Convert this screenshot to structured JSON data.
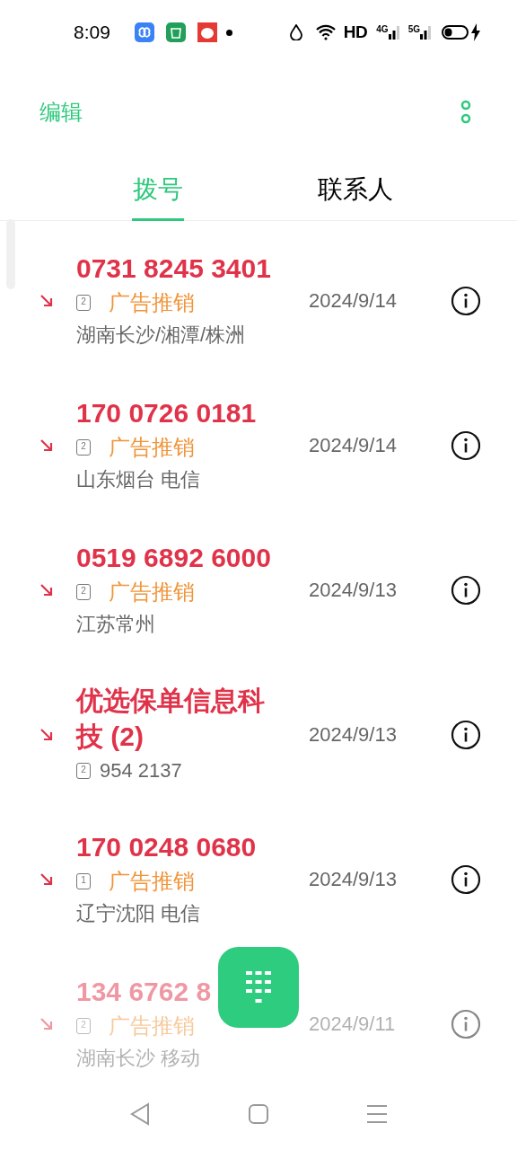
{
  "status_bar": {
    "time": "8:09",
    "hd": "HD",
    "networks": [
      "4G",
      "5G"
    ]
  },
  "header": {
    "edit": "编辑"
  },
  "tabs": [
    {
      "label": "拨号",
      "selected": true
    },
    {
      "label": "联系人",
      "selected": false
    }
  ],
  "calls": [
    {
      "name": "0731 8245 3401",
      "sim": "2",
      "tag": "广告推销",
      "location": "湖南长沙/湘潭/株洲",
      "date": "2024/9/14",
      "faded": false
    },
    {
      "name": "170 0726 0181",
      "sim": "2",
      "tag": "广告推销",
      "location": "山东烟台 电信",
      "date": "2024/9/14",
      "faded": false
    },
    {
      "name": "0519 6892 6000",
      "sim": "2",
      "tag": "广告推销",
      "location": "江苏常州",
      "date": "2024/9/13",
      "faded": false
    },
    {
      "name": "优选保单信息科技 (2)",
      "sim": "2",
      "number": "954 2137",
      "date": "2024/9/13",
      "faded": false
    },
    {
      "name": "170 0248 0680",
      "sim": "1",
      "tag": "广告推销",
      "location": "辽宁沈阳 电信",
      "date": "2024/9/13",
      "faded": false
    },
    {
      "name": "134 6762 8",
      "sim": "2",
      "tag": "广告推销",
      "location": "湖南长沙 移动",
      "date": "2024/9/11",
      "faded": true
    }
  ]
}
